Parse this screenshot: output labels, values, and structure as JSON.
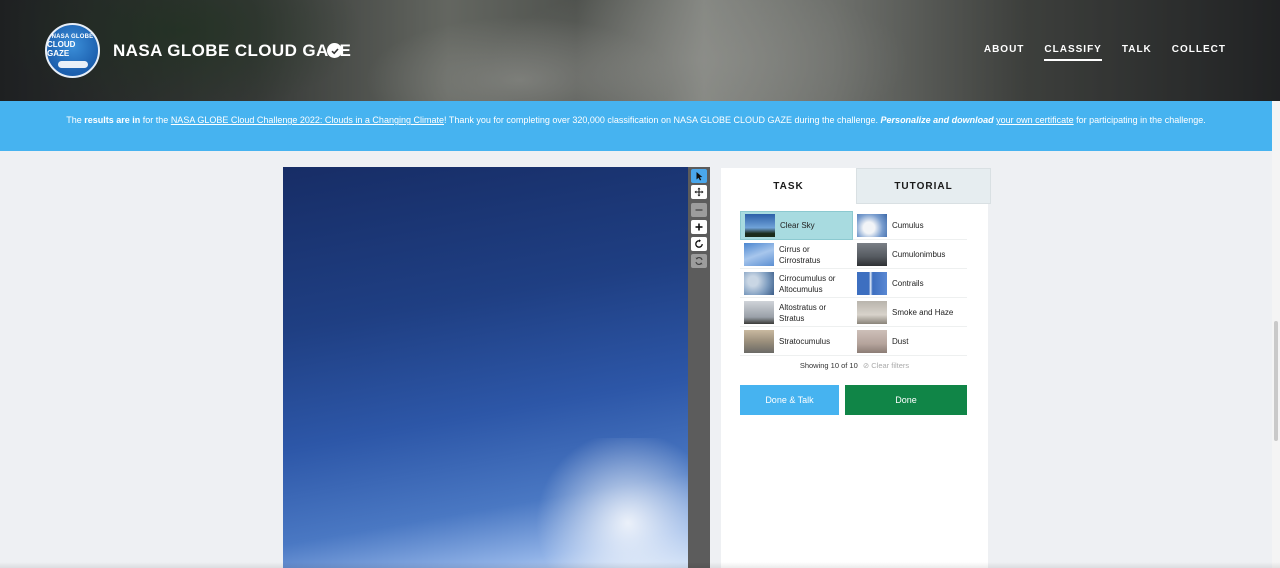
{
  "header": {
    "logo": {
      "line1": "NASA GLOBE",
      "line2": "CLOUD GAZE"
    },
    "title": "NASA GLOBE CLOUD GAZE",
    "nav": [
      "ABOUT",
      "CLASSIFY",
      "TALK",
      "COLLECT"
    ],
    "active_nav": "CLASSIFY"
  },
  "banner": {
    "p1": "The ",
    "b1": "results are in",
    "p2": " for the ",
    "link1": "NASA GLOBE Cloud Challenge 2022: Clouds in a Changing Climate",
    "p3": "! Thank you for completing over 320,000 classification on NASA GLOBE CLOUD GAZE during the challenge. ",
    "b2": "Personalize and download",
    "p4": " ",
    "link2": "your own certificate",
    "p5": " for participating in the challenge."
  },
  "panel": {
    "tabs": [
      "TASK",
      "TUTORIAL"
    ],
    "choices": [
      {
        "label": "Clear Sky",
        "selected": true
      },
      {
        "label": "Cumulus"
      },
      {
        "label": "Cirrus or Cirrostratus"
      },
      {
        "label": "Cumulonimbus"
      },
      {
        "label": "Cirrocumulus or Altocumulus"
      },
      {
        "label": "Contrails"
      },
      {
        "label": "Altostratus or Stratus"
      },
      {
        "label": "Smoke and Haze"
      },
      {
        "label": "Stratocumulus"
      },
      {
        "label": "Dust"
      }
    ],
    "showing": "Showing 10 of 10",
    "clear_filters": "⊘ Clear filters",
    "done_talk": "Done & Talk",
    "done": "Done"
  },
  "colors": {
    "banner": "#46b3f0",
    "done_button": "#108547",
    "selected_choice": "#a8dbe0"
  }
}
